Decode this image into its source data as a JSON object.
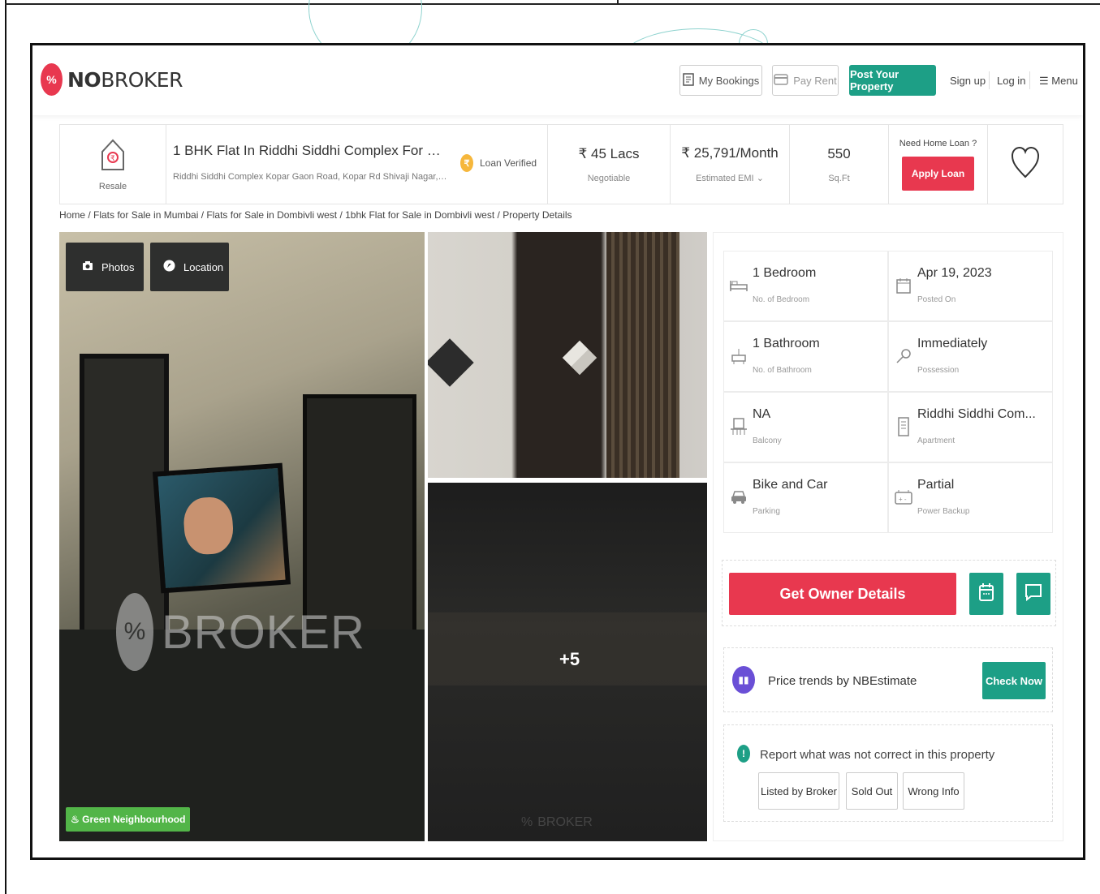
{
  "header": {
    "logo_text_bold": "NO",
    "logo_text_rest": "BROKER",
    "my_bookings": "My Bookings",
    "pay_rent": "Pay Rent",
    "post_property": "Post Your Property",
    "sign_up": "Sign up",
    "log_in": "Log in",
    "menu": "Menu"
  },
  "summary": {
    "resale_label": "Resale",
    "title": "1 BHK Flat In Riddhi Siddhi Complex For Sale In Do...",
    "address": "Riddhi Siddhi Complex Kopar Gaon Road, Kopar Rd Shivaji Nagar, Ko...",
    "loan_verified": "Loan Verified",
    "price": "₹ 45 Lacs",
    "price_note": "Negotiable",
    "emi": "₹ 25,791/Month",
    "emi_note": "Estimated EMI",
    "area": "550",
    "area_unit": "Sq.Ft",
    "need_loan": "Need Home Loan ?",
    "apply_loan": "Apply Loan"
  },
  "breadcrumb": "Home / Flats for Sale in Mumbai / Flats for Sale in Dombivli west / 1bhk Flat for Sale in Dombivli west / Property Details",
  "gallery": {
    "photos_label": "Photos",
    "location_label": "Location",
    "green_tag": "Green Neighbourhood",
    "more_count": "+5"
  },
  "details": [
    {
      "icon": "bed-icon",
      "value": "1 Bedroom",
      "label": "No. of Bedroom"
    },
    {
      "icon": "calendar-icon",
      "value": "Apr 19, 2023",
      "label": "Posted On"
    },
    {
      "icon": "bathroom-icon",
      "value": "1 Bathroom",
      "label": "No. of Bathroom"
    },
    {
      "icon": "key-icon",
      "value": "Immediately",
      "label": "Possession"
    },
    {
      "icon": "balcony-icon",
      "value": "NA",
      "label": "Balcony"
    },
    {
      "icon": "building-icon",
      "value": "Riddhi Siddhi Com...",
      "label": "Apartment"
    },
    {
      "icon": "car-icon",
      "value": "Bike and Car",
      "label": "Parking"
    },
    {
      "icon": "power-icon",
      "value": "Partial",
      "label": "Power Backup"
    }
  ],
  "actions": {
    "get_owner": "Get Owner Details",
    "trend_text": "Price trends by NBEstimate",
    "check_now": "Check Now",
    "report_text": "Report what was not correct in this property",
    "report_options": [
      "Listed by Broker",
      "Sold Out",
      "Wrong Info"
    ]
  },
  "colors": {
    "brand_red": "#e8384f",
    "brand_green": "#1d9f86"
  }
}
